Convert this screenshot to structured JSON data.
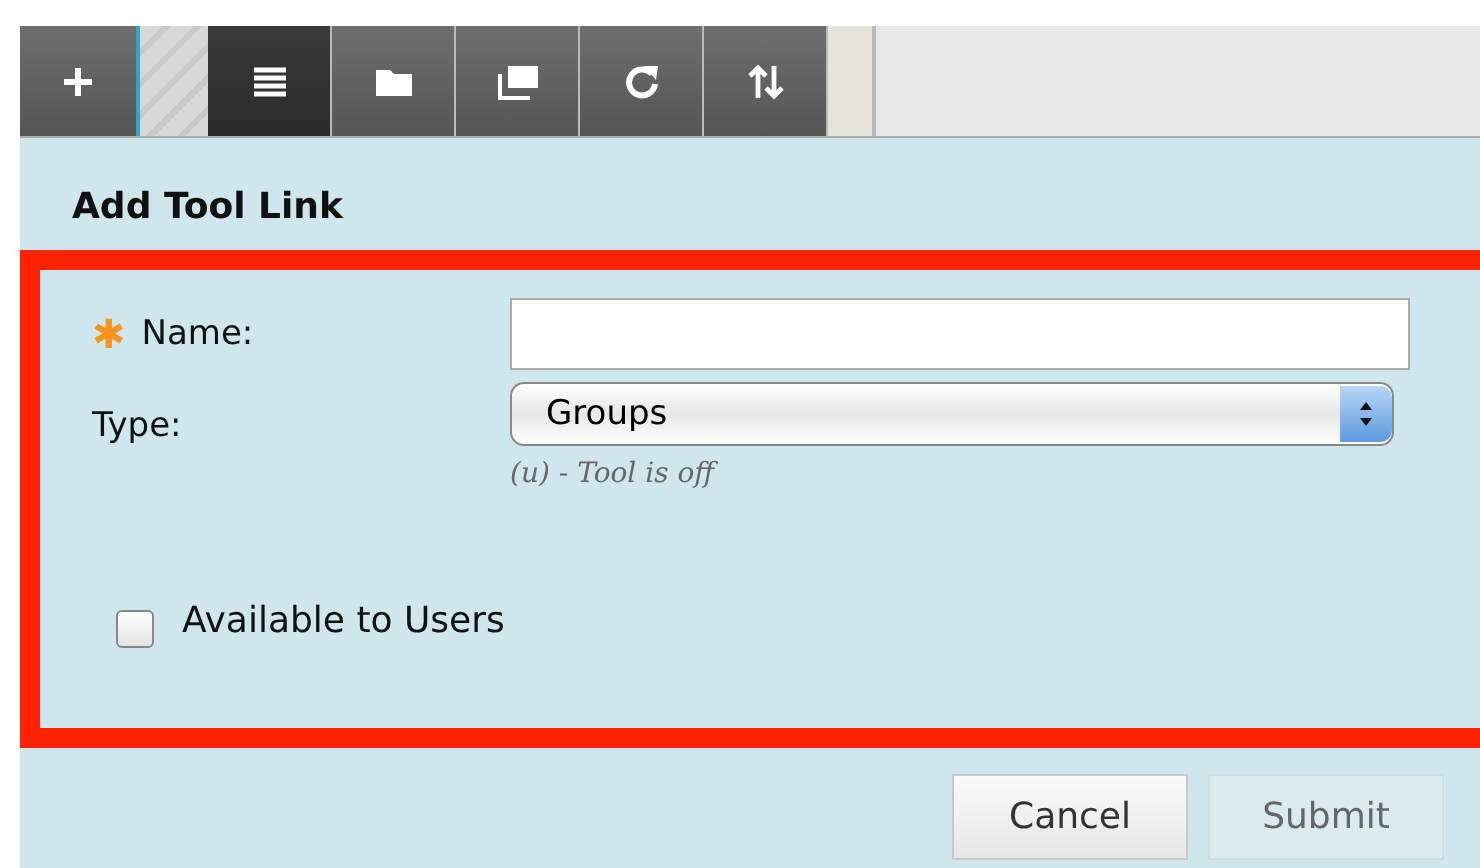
{
  "toolbar": {
    "buttons": [
      {
        "kind": "add",
        "selected": false
      },
      {
        "kind": "list",
        "selected": true
      },
      {
        "kind": "folder",
        "selected": false
      },
      {
        "kind": "windows",
        "selected": false
      },
      {
        "kind": "refresh",
        "selected": false
      },
      {
        "kind": "sort",
        "selected": false
      }
    ]
  },
  "panel": {
    "title": "Add Tool Link",
    "fields": [
      {
        "kind": "text",
        "label": "Name:",
        "required": true,
        "required_mark": "✱"
      },
      {
        "kind": "select",
        "label": "Type:",
        "value": "Groups",
        "hint": "(u) - Tool is off"
      }
    ],
    "checkbox": {
      "label": "Available to Users",
      "checked": false
    },
    "buttons": [
      {
        "label": "Cancel",
        "disabled": false
      },
      {
        "label": "Submit",
        "disabled": true
      }
    ]
  }
}
